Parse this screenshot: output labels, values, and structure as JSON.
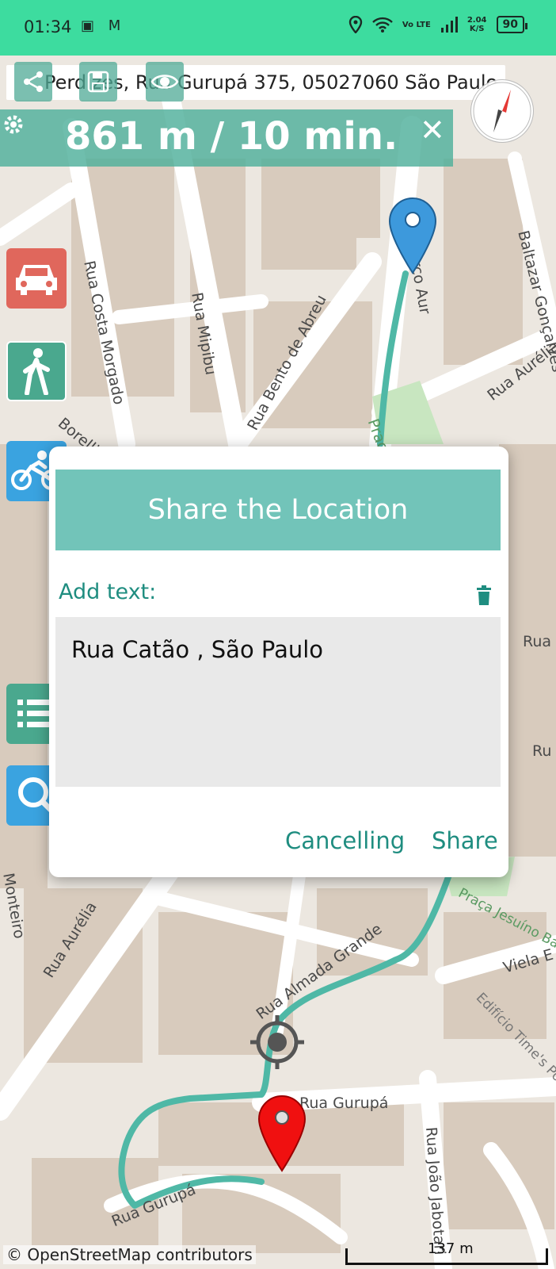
{
  "status_bar": {
    "time": "01:34",
    "left_icons": "▣ M",
    "network": "Vo LTE",
    "speed_top": "2.04",
    "speed_bottom": "K/S",
    "battery": "90"
  },
  "address": "Perdizes, Rua Gurupá 375, 05027060 São Paulo",
  "route": {
    "distance": "861 m / 10 min."
  },
  "map_labels": [
    "Rua Costa Morgado",
    "Rua Mipibu",
    "Rua Bento de Abreu",
    "Marco Aur",
    "Baltazar Gonçalves",
    "Rua Aurélia",
    "Borelli",
    "Praça Cl",
    "Rua Gurupá",
    "Rua João Jabotari",
    "Viela E",
    "Edifício Time's Pompéia",
    "Praça Jesuíno Bandeira",
    "Rua Aurélia",
    "Rua Almada Grande",
    "Rua Gurupá",
    "Monteiro",
    "Rua",
    "Ru"
  ],
  "dialog": {
    "title": "Share the Location",
    "add_text_label": "Add text:",
    "text_value": "Rua Catão , São Paulo",
    "cancel_label": "Cancelling",
    "share_label": "Share"
  },
  "attribution": "© OpenStreetMap contributors",
  "scale_label": "137 m",
  "colors": {
    "status_bar": "#3ddc9f",
    "route": "#4fb8a6",
    "accent_teal": "#1f8d80",
    "dialog_header": "#72c4b9",
    "car_button": "#e0675c",
    "walk_button": "#4aa88e",
    "bike_button": "#3aa3e0"
  },
  "icons": [
    "share-icon",
    "save-icon",
    "eye-icon",
    "gear-icon",
    "close-icon",
    "compass-icon",
    "car-icon",
    "walk-icon",
    "bike-icon",
    "list-icon",
    "search-icon",
    "trash-icon",
    "start-marker-icon",
    "end-marker-icon",
    "location-target-icon"
  ]
}
